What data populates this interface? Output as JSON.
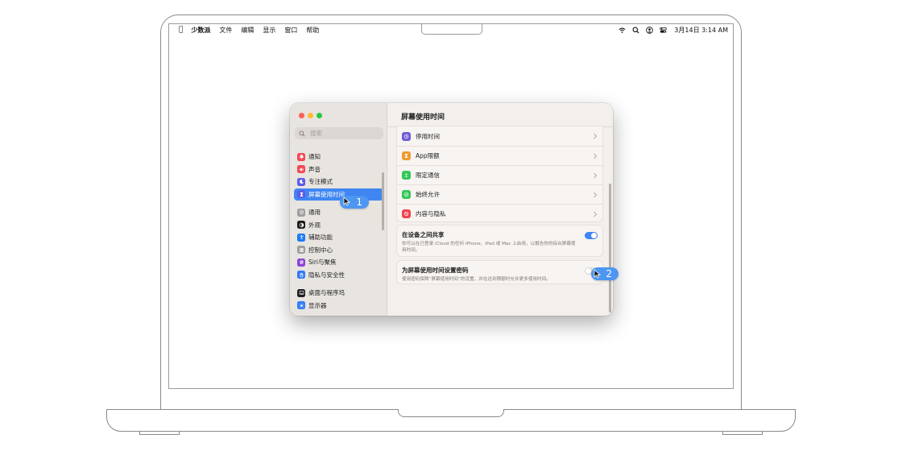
{
  "menubar": {
    "app_name": "少数派",
    "menus": [
      "文件",
      "编辑",
      "显示",
      "窗口",
      "帮助"
    ],
    "clock": "3月14日  3:14 AM"
  },
  "window": {
    "pane_title": "屏幕使用时间",
    "search_placeholder": "搜索",
    "sidebar": [
      {
        "label": "通知",
        "icon": "bell-icon",
        "color": "#f24a55"
      },
      {
        "label": "声音",
        "icon": "speaker-icon",
        "color": "#f24a55"
      },
      {
        "label": "专注模式",
        "icon": "moon-icon",
        "color": "#5e5ce6"
      },
      {
        "label": "屏幕使用时间",
        "icon": "hourglass-icon",
        "color": "#5e5ce6",
        "selected": true
      },
      {
        "label": "通用",
        "icon": "gear-icon",
        "color": "#9e9e9e"
      },
      {
        "label": "外观",
        "icon": "appearance-icon",
        "color": "#1d1d1f"
      },
      {
        "label": "辅助功能",
        "icon": "accessibility-icon",
        "color": "#1a7cf4"
      },
      {
        "label": "控制中心",
        "icon": "control-center-icon",
        "color": "#9e9e9e"
      },
      {
        "label": "Siri与聚焦",
        "icon": "siri-icon",
        "color": "#8a45d8"
      },
      {
        "label": "隐私与安全性",
        "icon": "hand-icon",
        "color": "#2f7cf6"
      },
      {
        "label": "桌面与程序坞",
        "icon": "dock-icon",
        "color": "#1d1d1f"
      },
      {
        "label": "显示器",
        "icon": "sun-icon",
        "color": "#2f7cf6"
      }
    ],
    "rows": [
      {
        "label": "停用时间",
        "icon": "downtime-icon",
        "color": "#6e5bd6"
      },
      {
        "label": "App限额",
        "icon": "hourglass-icon",
        "color": "#f09a30"
      },
      {
        "label": "限定通信",
        "icon": "communication-icon",
        "color": "#34c759"
      },
      {
        "label": "始终允许",
        "icon": "checkmark-icon",
        "color": "#34c759"
      },
      {
        "label": "内容与隐私",
        "icon": "restriction-icon",
        "color": "#f0424e"
      }
    ],
    "share": {
      "title": "在设备之间共享",
      "desc": "你可以在已登录 iCloud 的任何 iPhone、iPad 或 Mac 上启用，以报告你的综合屏幕使用时间。",
      "on": true
    },
    "passcode": {
      "title": "为屏幕使用时间设置密码",
      "desc": "使用密码保障“屏幕使用时间”的设置，并在达到限额时允许更多使用时间。",
      "on": false
    },
    "help": "?"
  },
  "badges": [
    "1",
    "2"
  ],
  "colors": {
    "accent": "#3f86f3",
    "badge": "#4d96f2"
  }
}
